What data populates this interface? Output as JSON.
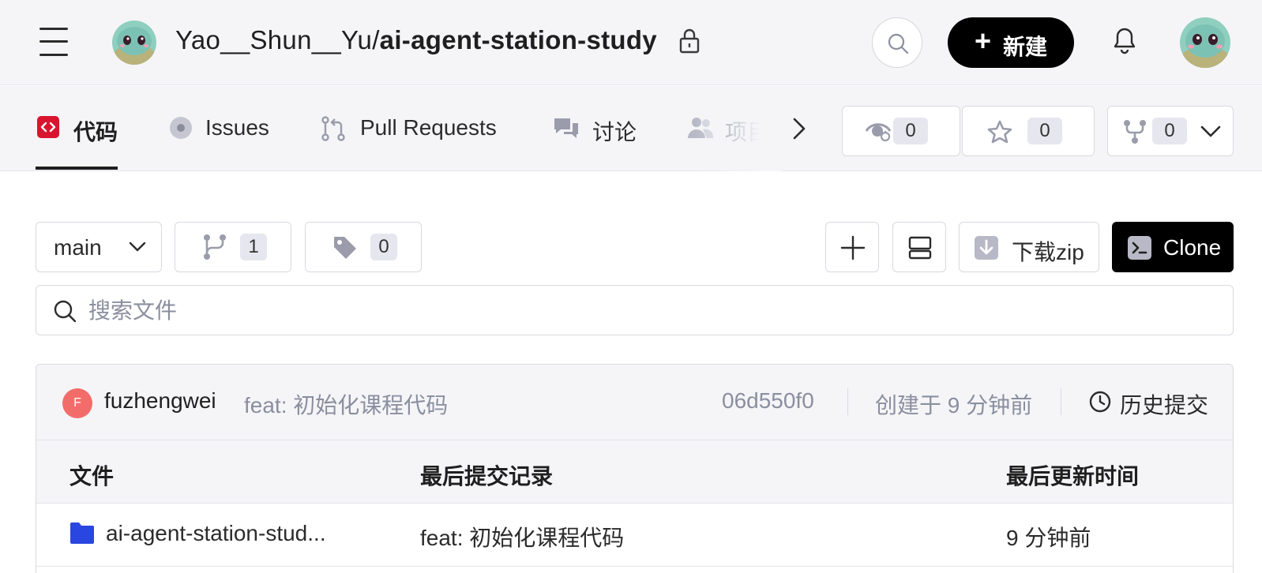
{
  "header": {
    "repo_owner": "Yao__Shun__Yu/",
    "repo_name": "ai-agent-station-study",
    "new_label": "新建",
    "new_plus": "+"
  },
  "tabs": [
    {
      "label": "代码",
      "icon": "code-icon",
      "active": true
    },
    {
      "label": "Issues",
      "icon": "issues-icon"
    },
    {
      "label": "Pull Requests",
      "icon": "pull-request-icon"
    },
    {
      "label": "讨论",
      "icon": "discussion-icon"
    },
    {
      "label": "项目",
      "icon": "project-icon"
    }
  ],
  "stats": {
    "watch": "0",
    "star": "0",
    "fork": "0"
  },
  "toolbar": {
    "branch": "main",
    "branches_count": "1",
    "tags_count": "0",
    "download_zip": "下载zip",
    "clone": "Clone"
  },
  "search": {
    "placeholder": "搜索文件"
  },
  "commit": {
    "author_initial": "F",
    "author": "fuzhengwei",
    "message": "feat: 初始化课程代码",
    "hash": "06d550f0",
    "time": "创建于 9 分钟前",
    "history": "历史提交"
  },
  "table": {
    "headers": [
      "文件",
      "最后提交记录",
      "最后更新时间"
    ],
    "rows": [
      {
        "name": "ai-agent-station-stud...",
        "commit": "feat: 初始化课程代码",
        "updated": "9 分钟前",
        "type": "folder"
      }
    ]
  },
  "colors": {
    "accent": "#d9142f",
    "folder": "#2a46e0",
    "author_avatar": "#f26d6a"
  }
}
